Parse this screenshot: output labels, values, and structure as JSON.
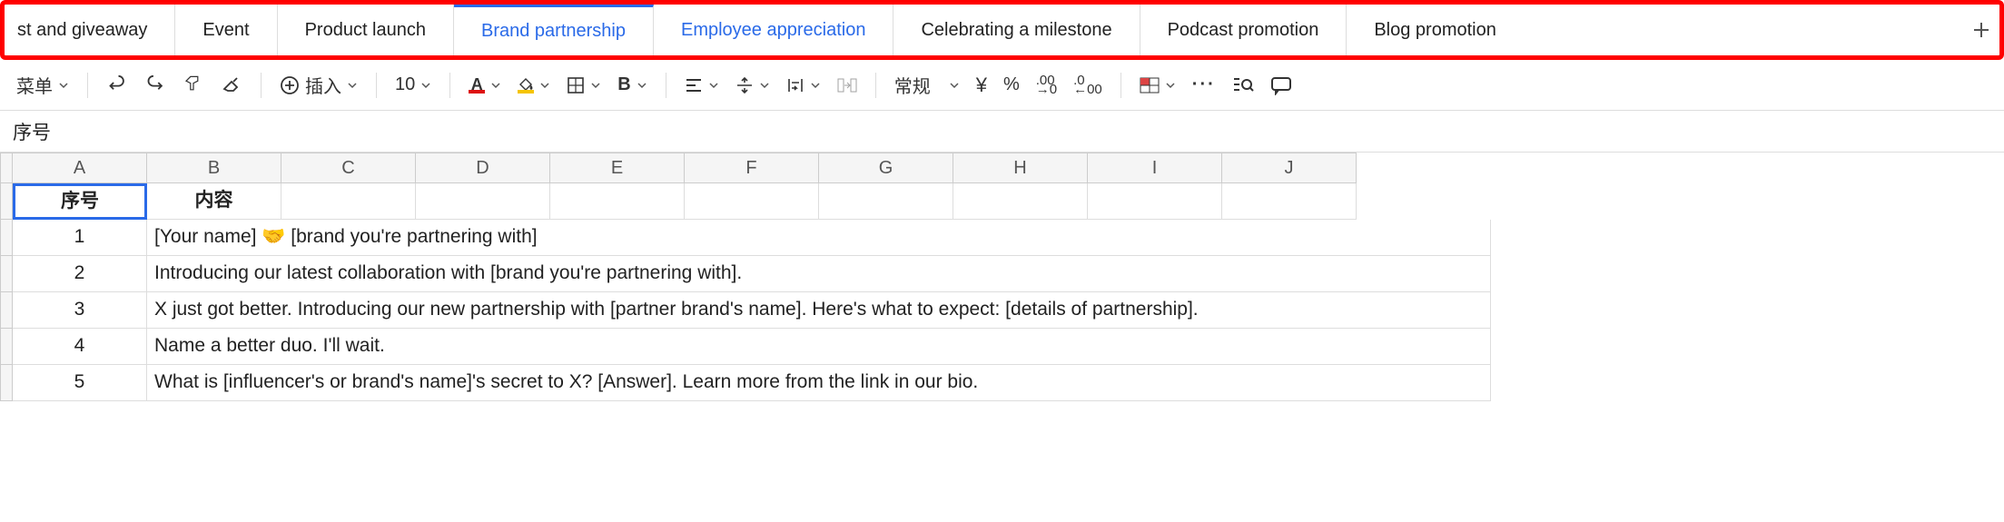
{
  "tabs": {
    "t0": "st and giveaway",
    "t1": "Event",
    "t2": "Product launch",
    "t3": "Brand partnership",
    "t4": "Employee appreciation",
    "t5": "Celebrating a milestone",
    "t6": "Podcast promotion",
    "t7": "Blog promotion"
  },
  "toolbar": {
    "menu": "菜单",
    "insert": "插入",
    "font_size": "10",
    "bold": "B",
    "number_format": "常规",
    "currency": "¥",
    "percent": "%"
  },
  "formula_bar": {
    "value": "序号"
  },
  "columns": {
    "A": "A",
    "B": "B",
    "C": "C",
    "D": "D",
    "E": "E",
    "F": "F",
    "G": "G",
    "H": "H",
    "I": "I",
    "J": "J"
  },
  "rows": {
    "header": {
      "a": "序号",
      "b": "内容"
    },
    "r1": {
      "num": "1",
      "content": "[Your name] 🤝 [brand you're partnering with]"
    },
    "r2": {
      "num": "2",
      "content": "Introducing our latest collaboration with [brand you're partnering with]."
    },
    "r3": {
      "num": "3",
      "content": "X just got better. Introducing our new partnership with [partner brand's name]. Here's what to expect: [details of partnership]."
    },
    "r4": {
      "num": "4",
      "content": "Name a better duo. I'll wait."
    },
    "r5": {
      "num": "5",
      "content": "What is [influencer's or brand's name]'s secret to X? [Answer]. Learn more from the link in our bio."
    }
  }
}
